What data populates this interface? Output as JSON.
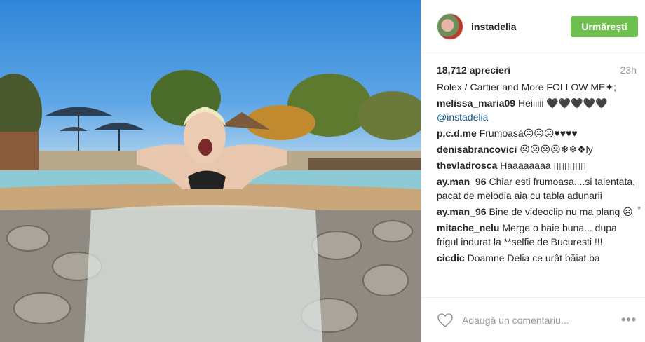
{
  "post": {
    "author": "instadelia",
    "follow_label": "Urmărești",
    "likes": "18,712 aprecieri",
    "time": "23h",
    "comments": [
      {
        "user": "",
        "text": "Rolex / Cartier and More FOLLOW ME✦;"
      },
      {
        "user": "melissa_maria09",
        "text": "Heiiiiii 🖤🖤🖤🖤🖤",
        "mention": "@instadelia"
      },
      {
        "user": "p.c.d.me",
        "text": "Frumoasă☹☹☹♥♥♥♥"
      },
      {
        "user": "denisabrancovici",
        "text": "☹☹☹☹❄❄❖ly"
      },
      {
        "user": "thevladrosca",
        "text": "Haaaaaaaa ▯▯▯▯▯▯"
      },
      {
        "user": "ay.man_96",
        "text": "Chiar esti frumoasa....si talentata, pacat de melodia aia cu tabla adunarii"
      },
      {
        "user": "ay.man_96",
        "text": "Bine de videoclip nu ma plang ☹"
      },
      {
        "user": "mitache_nelu",
        "text": "Merge o baie buna... dupa frigul indurat la **selfie de Bucuresti !!!"
      },
      {
        "user": "cicdic",
        "text": "Doamne Delia ce urât băiat ba"
      }
    ],
    "comment_placeholder": "Adaugă un comentariu...",
    "more_label": "•••"
  },
  "icons": {
    "like": "heart-outline-icon",
    "options": "more-options-icon",
    "scroll": "scroll-down-arrow-icon"
  },
  "colors": {
    "follow_bg": "#70c050",
    "mention": "#125688",
    "muted": "#999999"
  }
}
